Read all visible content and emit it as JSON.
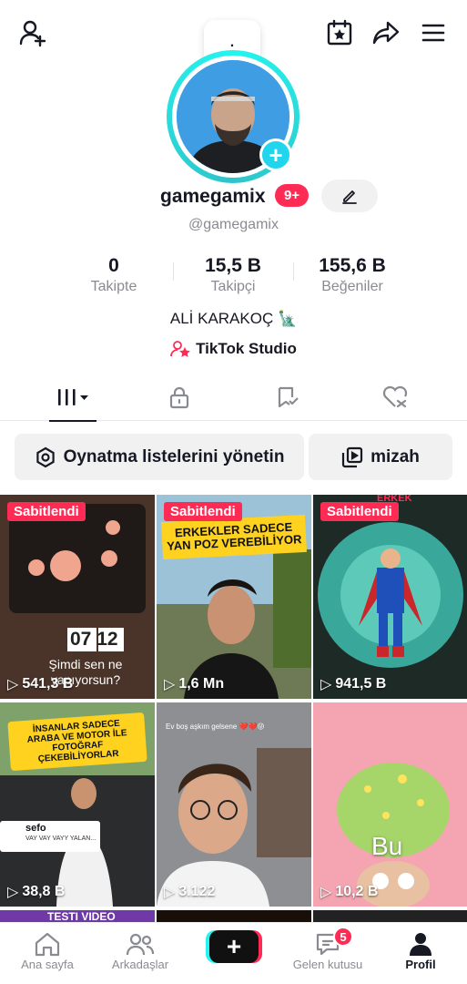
{
  "header": {
    "bubble_text": ".",
    "icons": [
      "add-user-icon",
      "calendar-star-icon",
      "share-icon",
      "menu-icon"
    ]
  },
  "profile": {
    "username": "gamegamix",
    "notification_badge": "9+",
    "handle": "@gamegamix",
    "bio": "ALİ KARAKOÇ 🗽",
    "studio_label": "TikTok Studio"
  },
  "stats": {
    "following": {
      "value": "0",
      "label": "Takipte"
    },
    "followers": {
      "value": "15,5 B",
      "label": "Takipçi"
    },
    "likes": {
      "value": "155,6 B",
      "label": "Beğeniler"
    }
  },
  "tabs": [
    "videos-tab",
    "private-tab",
    "reposts-tab",
    "liked-tab"
  ],
  "actions": {
    "playlists_label": "Oynatma listelerini yönetin",
    "playlist_name": "mizah"
  },
  "videos": [
    {
      "pinned": "Sabitlendi",
      "plays": "541,3 B",
      "overlay": "Şimdi sen ne\nyapıyorsun?",
      "clock": "07 12"
    },
    {
      "pinned": "Sabitlendi",
      "plays": "1,6 Mn",
      "banner": "ERKEKLER SADECE\nYAN POZ VEREBİLİYOR"
    },
    {
      "pinned": "Sabitlendi",
      "plays": "941,5 B",
      "corner_text": "ERKEK"
    },
    {
      "plays": "38,8 B",
      "banner": "İNSANLAR SADECE\nARABA VE MOTOR İLE\nFOTOĞRAF ÇEKEBİLİYORLAR",
      "comment_user": "sefo",
      "comment_text": "VAY VAY VAYY YALAN..."
    },
    {
      "plays": "3.122",
      "caption": "Ev boş aşkım gelsene ❤️❤️😜"
    },
    {
      "plays": "10,2 B",
      "overlay": "Bu"
    }
  ],
  "bottom_partial": {
    "label": "TESTI VIDEO"
  },
  "bottom_nav": {
    "home": "Ana sayfa",
    "friends": "Arkadaşlar",
    "inbox": "Gelen kutusu",
    "inbox_badge": "5",
    "profile": "Profil"
  },
  "colors": {
    "accent": "#fe2c55",
    "cyan": "#25f4ee",
    "pinned": "#fe2c55",
    "banner": "#ffd21f"
  }
}
